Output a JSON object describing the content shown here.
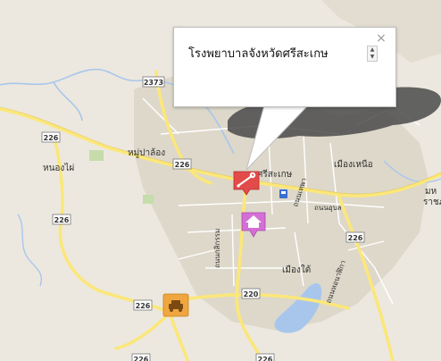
{
  "info_window": {
    "title": "โรงพยาบาลจังหวัดศรีสะเกษ"
  },
  "places": {
    "city_center": "ศรีสะเกษ",
    "mueang_nuea": "เมืองเหนือ",
    "mueang_tai": "เมืองใต้",
    "nong_phai": "หนองไผ่",
    "mu_plalong": "หมู่ปาล้อง",
    "edge_right": "มห\nราชภ"
  },
  "roads": {
    "thanon_ubon": "ถนนอุบล",
    "thanon_kasikam": "ถนนกสิกรรม",
    "thanon_thepa": "ถนนเทพา",
    "thanon_ho_nalika": "ถนนหอนาฬิกา"
  },
  "route_shields": {
    "r2373": "2373",
    "r226_left": "226",
    "r226_mid": "226",
    "r226_nongphai": "226",
    "r226_right": "226",
    "r220": "220",
    "r226_bottom": "226",
    "r226_bottom_left": "226",
    "r226_bottom_right": "226"
  },
  "colors": {
    "land": "#ece8df",
    "urban": "#dcd7c9",
    "major_road": "#fbe77a",
    "minor_road": "#ffffff",
    "water": "#a8c6ec",
    "green": "#c6dcab",
    "marker_red": "#e34a4a",
    "marker_purple": "#d46fd6",
    "marker_orange": "#f0a640"
  },
  "markers": {
    "hospital": "wrench-marker",
    "temple": "temple-marker",
    "vehicle": "car-marker"
  }
}
